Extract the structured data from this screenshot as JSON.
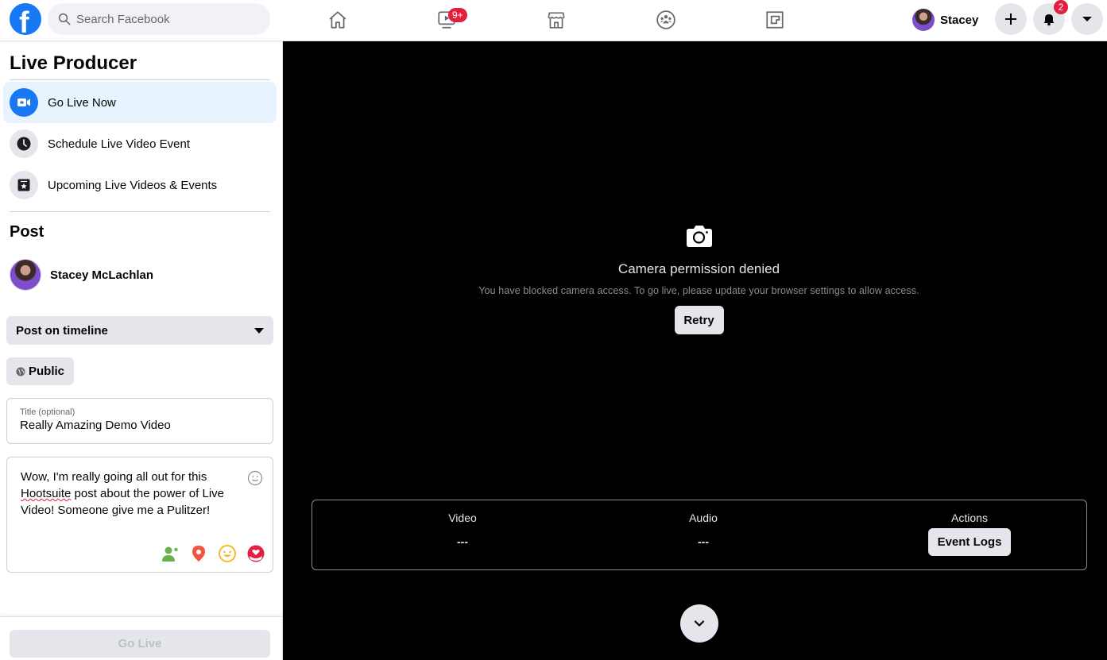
{
  "topbar": {
    "logo": "facebook-logo",
    "logo_glyph": "f",
    "search_placeholder": "Search Facebook",
    "nav": [
      {
        "name": "home",
        "icon": "home-icon"
      },
      {
        "name": "watch",
        "icon": "watch-icon",
        "badge": "9+"
      },
      {
        "name": "marketplace",
        "icon": "marketplace-icon"
      },
      {
        "name": "groups",
        "icon": "groups-icon"
      },
      {
        "name": "gaming",
        "icon": "gaming-icon"
      }
    ],
    "profile_name": "Stacey",
    "create_icon": "plus-icon",
    "notifications_badge": "2",
    "menu_icon": "caret-down-icon"
  },
  "sidebar": {
    "title": "Live Producer",
    "items": [
      {
        "label": "Go Live Now",
        "icon": "video-camera-icon",
        "active": true
      },
      {
        "label": "Schedule Live Video Event",
        "icon": "clock-icon",
        "active": false
      },
      {
        "label": "Upcoming Live Videos & Events",
        "icon": "calendar-star-icon",
        "active": false
      }
    ],
    "post_heading": "Post",
    "author_name": "Stacey McLachlan",
    "post_destination": "Post on timeline",
    "privacy": "Public",
    "title_field": {
      "label": "Title (optional)",
      "value": "Really Amazing Demo Video"
    },
    "description": {
      "before_misspelled": "Wow, I'm really going all out for this ",
      "misspelled": "Hootsuite",
      "after_misspelled": " post about the power of Live Video! Someone give me a Pulitzer!"
    },
    "description_tools": [
      "tag-people-icon",
      "location-icon",
      "feeling-icon",
      "support-icon"
    ],
    "go_live_label": "Go Live"
  },
  "main": {
    "camera_title": "Camera permission denied",
    "camera_message": "You have blocked camera access. To go live, please update your browser settings to allow access.",
    "retry_label": "Retry",
    "stats": {
      "video_label": "Video",
      "video_value": "---",
      "audio_label": "Audio",
      "audio_value": "---",
      "actions_label": "Actions",
      "event_logs_label": "Event Logs"
    }
  },
  "colors": {
    "brand": "#1877f2",
    "badge": "#e41e3f",
    "active_bg": "#e7f3ff",
    "button_bg": "#e4e6eb"
  }
}
